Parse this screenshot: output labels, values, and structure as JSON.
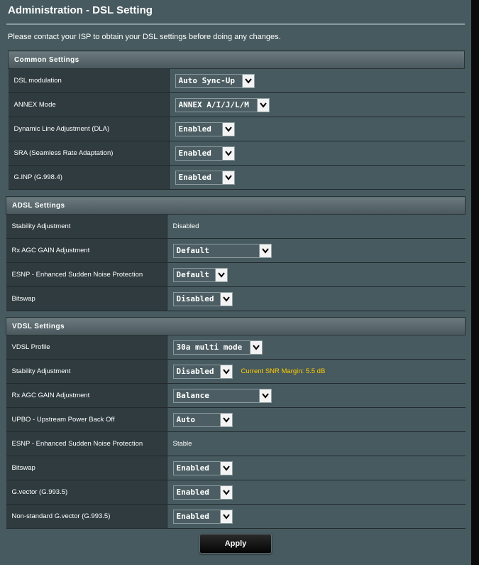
{
  "page": {
    "title": "Administration - DSL Setting",
    "notice": "Please contact your ISP to obtain your DSL settings before doing any changes."
  },
  "common": {
    "header": "Common Settings",
    "rows": [
      {
        "label": "DSL modulation",
        "value": "Auto Sync-Up"
      },
      {
        "label": "ANNEX Mode",
        "value": "ANNEX A/I/J/L/M"
      },
      {
        "label": "Dynamic Line Adjustment (DLA)",
        "value": "Enabled"
      },
      {
        "label": "SRA (Seamless Rate Adaptation)",
        "value": "Enabled"
      },
      {
        "label": "G.INP (G.998.4)",
        "value": "Enabled"
      }
    ]
  },
  "adsl": {
    "header": "ADSL Settings",
    "rows": [
      {
        "label": "Stability Adjustment",
        "value": "Disabled"
      },
      {
        "label": "Rx AGC GAIN Adjustment",
        "value": "Default"
      },
      {
        "label": "ESNP - Enhanced Sudden Noise Protection",
        "value": "Default"
      },
      {
        "label": "Bitswap",
        "value": "Disabled"
      }
    ]
  },
  "vdsl": {
    "header": "VDSL Settings",
    "rows": [
      {
        "label": "VDSL Profile",
        "value": "30a multi mode"
      },
      {
        "label": "Stability Adjustment",
        "value": "Disabled",
        "note": "Current SNR Margin: 5.5 dB"
      },
      {
        "label": "Rx AGC GAIN Adjustment",
        "value": "Balance"
      },
      {
        "label": "UPBO - Upstream Power Back Off",
        "value": "Auto"
      },
      {
        "label": "ESNP - Enhanced Sudden Noise Protection",
        "value": "Stable"
      },
      {
        "label": "Bitswap",
        "value": "Enabled"
      },
      {
        "label": "G.vector (G.993.5)",
        "value": "Enabled"
      },
      {
        "label": "Non-standard G.vector (G.993.5)",
        "value": "Enabled"
      }
    ]
  },
  "apply_label": "Apply",
  "icons": {
    "dropdown": "chevron-down-icon"
  },
  "colors": {
    "panel": "#475a5f",
    "label_cell": "#2f3b3f",
    "snr_note": "#ffcc00"
  }
}
